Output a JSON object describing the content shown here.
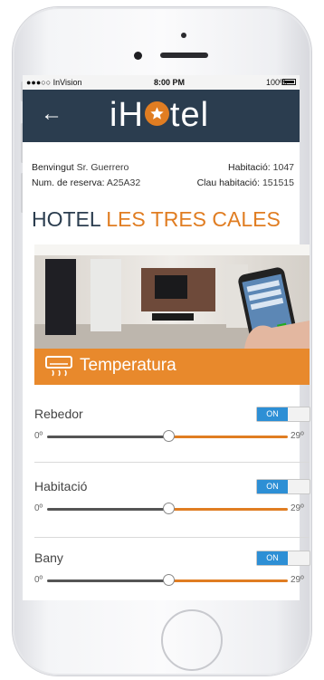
{
  "status_bar": {
    "carrier": "●●●○○ InVision",
    "time": "8:00 PM",
    "battery": "100%"
  },
  "header": {
    "back_symbol": "←",
    "logo_prefix": "iH",
    "logo_suffix": "tel",
    "background": "#2b3d4f",
    "logo_accent": "#e07d22"
  },
  "booking": {
    "welcome_label": "Benvingut",
    "guest": "Sr. Guerrero",
    "room_label": "Habitació:",
    "room_number": "1047",
    "reservation_label": "Num. de reserva:",
    "reservation_code": "A25A32",
    "key_label": "Clau habitació:",
    "key_code": "151515"
  },
  "hotel": {
    "name_prefix": "HOTEL",
    "name_highlight": "LES TRES CALES"
  },
  "section": {
    "title": "Temperatura",
    "icon": "air-conditioner-icon",
    "color": "#e8892c"
  },
  "rooms": [
    {
      "label": "Rebedor",
      "toggle": "ON",
      "min_label": "0º",
      "max_label": "29º",
      "value_fraction": 0.5
    },
    {
      "label": "Habitació",
      "toggle": "ON",
      "min_label": "0º",
      "max_label": "29º",
      "value_fraction": 0.5
    },
    {
      "label": "Bany",
      "toggle": "ON",
      "min_label": "0º",
      "max_label": "29º",
      "value_fraction": 0.5
    }
  ],
  "colors": {
    "toggle_on": "#2d8fd5",
    "slider_active": "#e07d22",
    "slider_inactive": "#555555"
  }
}
